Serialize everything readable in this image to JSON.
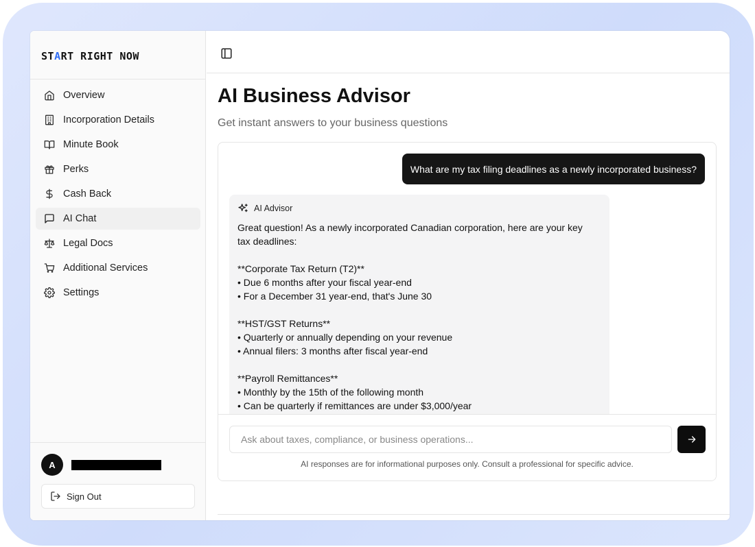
{
  "logo": {
    "pre": "ST",
    "accent": "A",
    "post": "RT RIGHT NOW",
    "accent_color": "#2f6df6"
  },
  "sidebar": {
    "items": [
      {
        "label": "Overview",
        "icon": "home-icon",
        "active": false
      },
      {
        "label": "Incorporation Details",
        "icon": "building-icon",
        "active": false
      },
      {
        "label": "Minute Book",
        "icon": "book-open-icon",
        "active": false
      },
      {
        "label": "Perks",
        "icon": "gift-icon",
        "active": false
      },
      {
        "label": "Cash Back",
        "icon": "dollar-icon",
        "active": false
      },
      {
        "label": "AI Chat",
        "icon": "chat-icon",
        "active": true
      },
      {
        "label": "Legal Docs",
        "icon": "scale-icon",
        "active": false
      },
      {
        "label": "Additional Services",
        "icon": "cart-icon",
        "active": false
      },
      {
        "label": "Settings",
        "icon": "gear-icon",
        "active": false
      }
    ],
    "user": {
      "avatar_initial": "A"
    },
    "sign_out_label": "Sign Out"
  },
  "main": {
    "title": "AI Business Advisor",
    "subtitle": "Get instant answers to your business questions",
    "chat": {
      "user_message": "What are my tax filing deadlines as a newly incorporated business?",
      "ai_label": "AI Advisor",
      "ai_lines": [
        "Great question! As a newly incorporated Canadian corporation, here are your key",
        "tax deadlines:",
        "",
        "**Corporate Tax Return (T2)**",
        "• Due 6 months after your fiscal year-end",
        "• For a December 31 year-end, that's June 30",
        "",
        "**HST/GST Returns**",
        "• Quarterly or annually depending on your revenue",
        "• Annual filers: 3 months after fiscal year-end",
        "",
        "**Payroll Remittances**",
        "• Monthly by the 15th of the following month",
        "• Can be quarterly if remittances are under $3,000/year"
      ],
      "input_placeholder": "Ask about taxes, compliance, or business operations...",
      "disclaimer": "AI responses are for informational purposes only. Consult a professional for specific advice."
    }
  }
}
